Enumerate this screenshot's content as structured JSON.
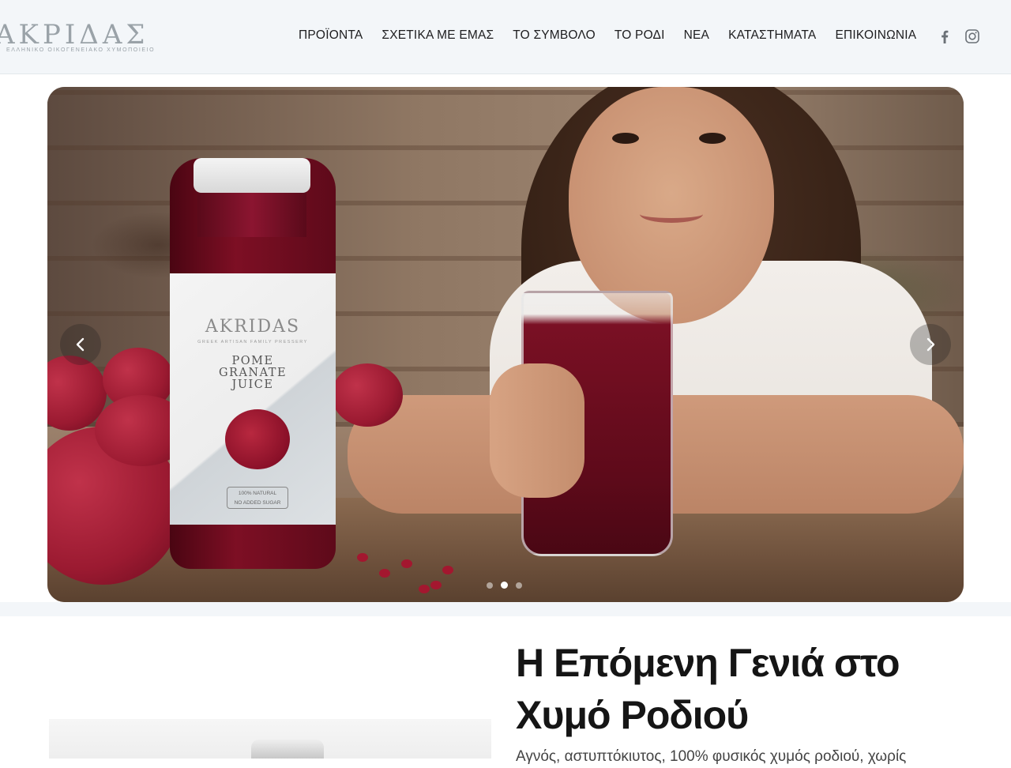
{
  "header": {
    "logo_text": "ΑΚΡΙΔΑΣ",
    "logo_tagline": "ΕΛΛΗΝΙΚΟ ΟΙΚΟΓΕΝΕΙΑΚΟ ΧΥΜΟΠΟΙΕΙΟ",
    "nav": [
      {
        "label": "ΠΡΟΪΟΝΤΑ"
      },
      {
        "label": "ΣΧΕΤΙΚΑ ΜΕ ΕΜΑΣ"
      },
      {
        "label": "ΤΟ ΣΥΜΒΟΛΟ"
      },
      {
        "label": "ΤΟ ΡΟΔΙ"
      },
      {
        "label": "ΝΕΑ"
      },
      {
        "label": "ΚΑΤΑΣΤΗΜΑΤΑ"
      },
      {
        "label": "ΕΠΙΚΟΙΝΩΝΙΑ"
      }
    ],
    "social": {
      "facebook_icon": "facebook-icon",
      "instagram_icon": "instagram-icon"
    }
  },
  "hero": {
    "bottle_label": {
      "brand": "AKRIDAS",
      "subtitle": "GREEK ARTISAN FAMILY PRESSERY",
      "product_line1": "POME",
      "product_line2": "GRANATE",
      "product_line3": "JUICE",
      "badge_line1": "100% NATURAL",
      "badge_line2": "NO ADDED SUGAR"
    },
    "prev_icon": "chevron-left-icon",
    "next_icon": "chevron-right-icon",
    "slides_total": 3,
    "active_slide": 2
  },
  "section": {
    "heading": "Η Επόμενη Γενιά στο Χυμό Ροδιού",
    "paragraph": "Αγνός, αστυπτόκιυτος, 100% φυσικός χυμός ροδιού, χωρίς"
  },
  "colors": {
    "header_bg": "#f3f6f9",
    "text_dark": "#1d1d1f",
    "logo_gray": "#9aa2a8",
    "juice_red": "#7d0f24"
  }
}
